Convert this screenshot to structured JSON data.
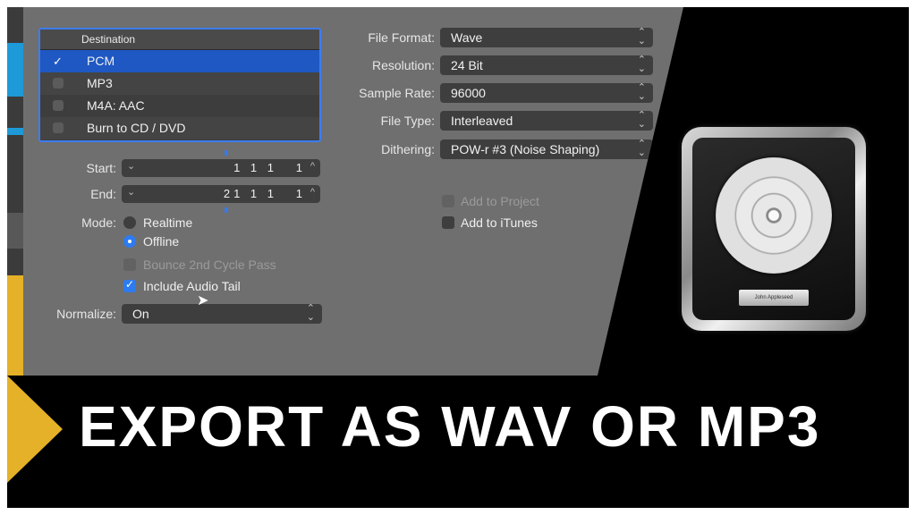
{
  "destination": {
    "header": "Destination",
    "rows": [
      {
        "label": "PCM",
        "checked": true
      },
      {
        "label": "MP3",
        "checked": false
      },
      {
        "label": "M4A: AAC",
        "checked": false
      },
      {
        "label": "Burn to CD / DVD",
        "checked": false
      }
    ]
  },
  "range": {
    "start_label": "Start:",
    "start_value": "1 1 1",
    "start_sub": "1",
    "end_label": "End:",
    "end_value": "21 1 1",
    "end_sub": "1"
  },
  "mode": {
    "label": "Mode:",
    "realtime": "Realtime",
    "offline": "Offline",
    "selected": "Offline"
  },
  "bounce_cycle": {
    "label": "Bounce 2nd Cycle Pass",
    "enabled": false
  },
  "audio_tail": {
    "label": "Include Audio Tail",
    "checked": true
  },
  "normalize": {
    "label": "Normalize:",
    "value": "On"
  },
  "format": {
    "file_format_label": "File Format:",
    "file_format": "Wave",
    "resolution_label": "Resolution:",
    "resolution": "24 Bit",
    "sample_rate_label": "Sample Rate:",
    "sample_rate": "96000",
    "file_type_label": "File Type:",
    "file_type": "Interleaved",
    "dithering_label": "Dithering:",
    "dithering": "POW-r #3 (Noise Shaping)"
  },
  "add_to_project": {
    "label": "Add to Project",
    "enabled": false
  },
  "add_to_itunes": {
    "label": "Add to iTunes",
    "checked": false
  },
  "logo": {
    "plate_text": "John Appleseed"
  },
  "banner": {
    "title": "EXPORT AS WAV OR MP3"
  },
  "colors": {
    "accent": "#2d7bf0",
    "banner_arrow": "#e4b128",
    "panel": "#6f6f6f"
  }
}
